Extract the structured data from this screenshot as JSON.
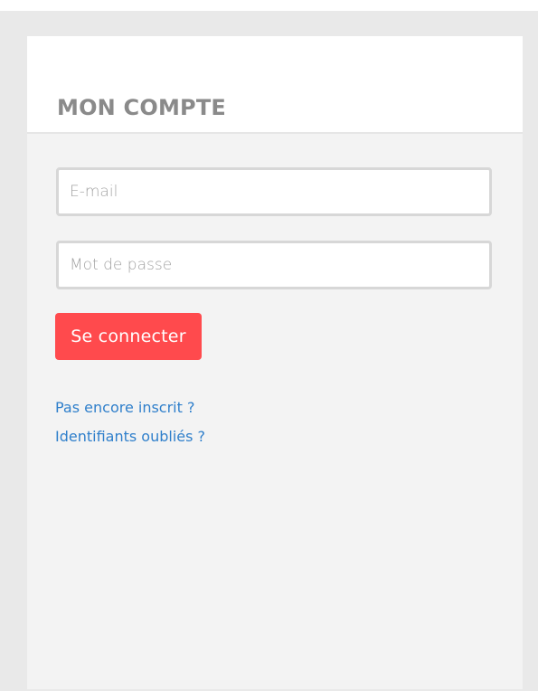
{
  "account_panel": {
    "title": "MON COMPTE",
    "email_placeholder": "E-mail",
    "password_placeholder": "Mot de passe",
    "login_button_label": "Se connecter",
    "register_link": "Pas encore inscrit ?",
    "forgot_link": "Identifiants oubliés ?"
  },
  "colors": {
    "button": "#ff4a4d",
    "link": "#2f7fcb",
    "title": "#8a8a8a",
    "panel_background": "#f3f3f3",
    "frame_background": "#e9e9e9"
  }
}
